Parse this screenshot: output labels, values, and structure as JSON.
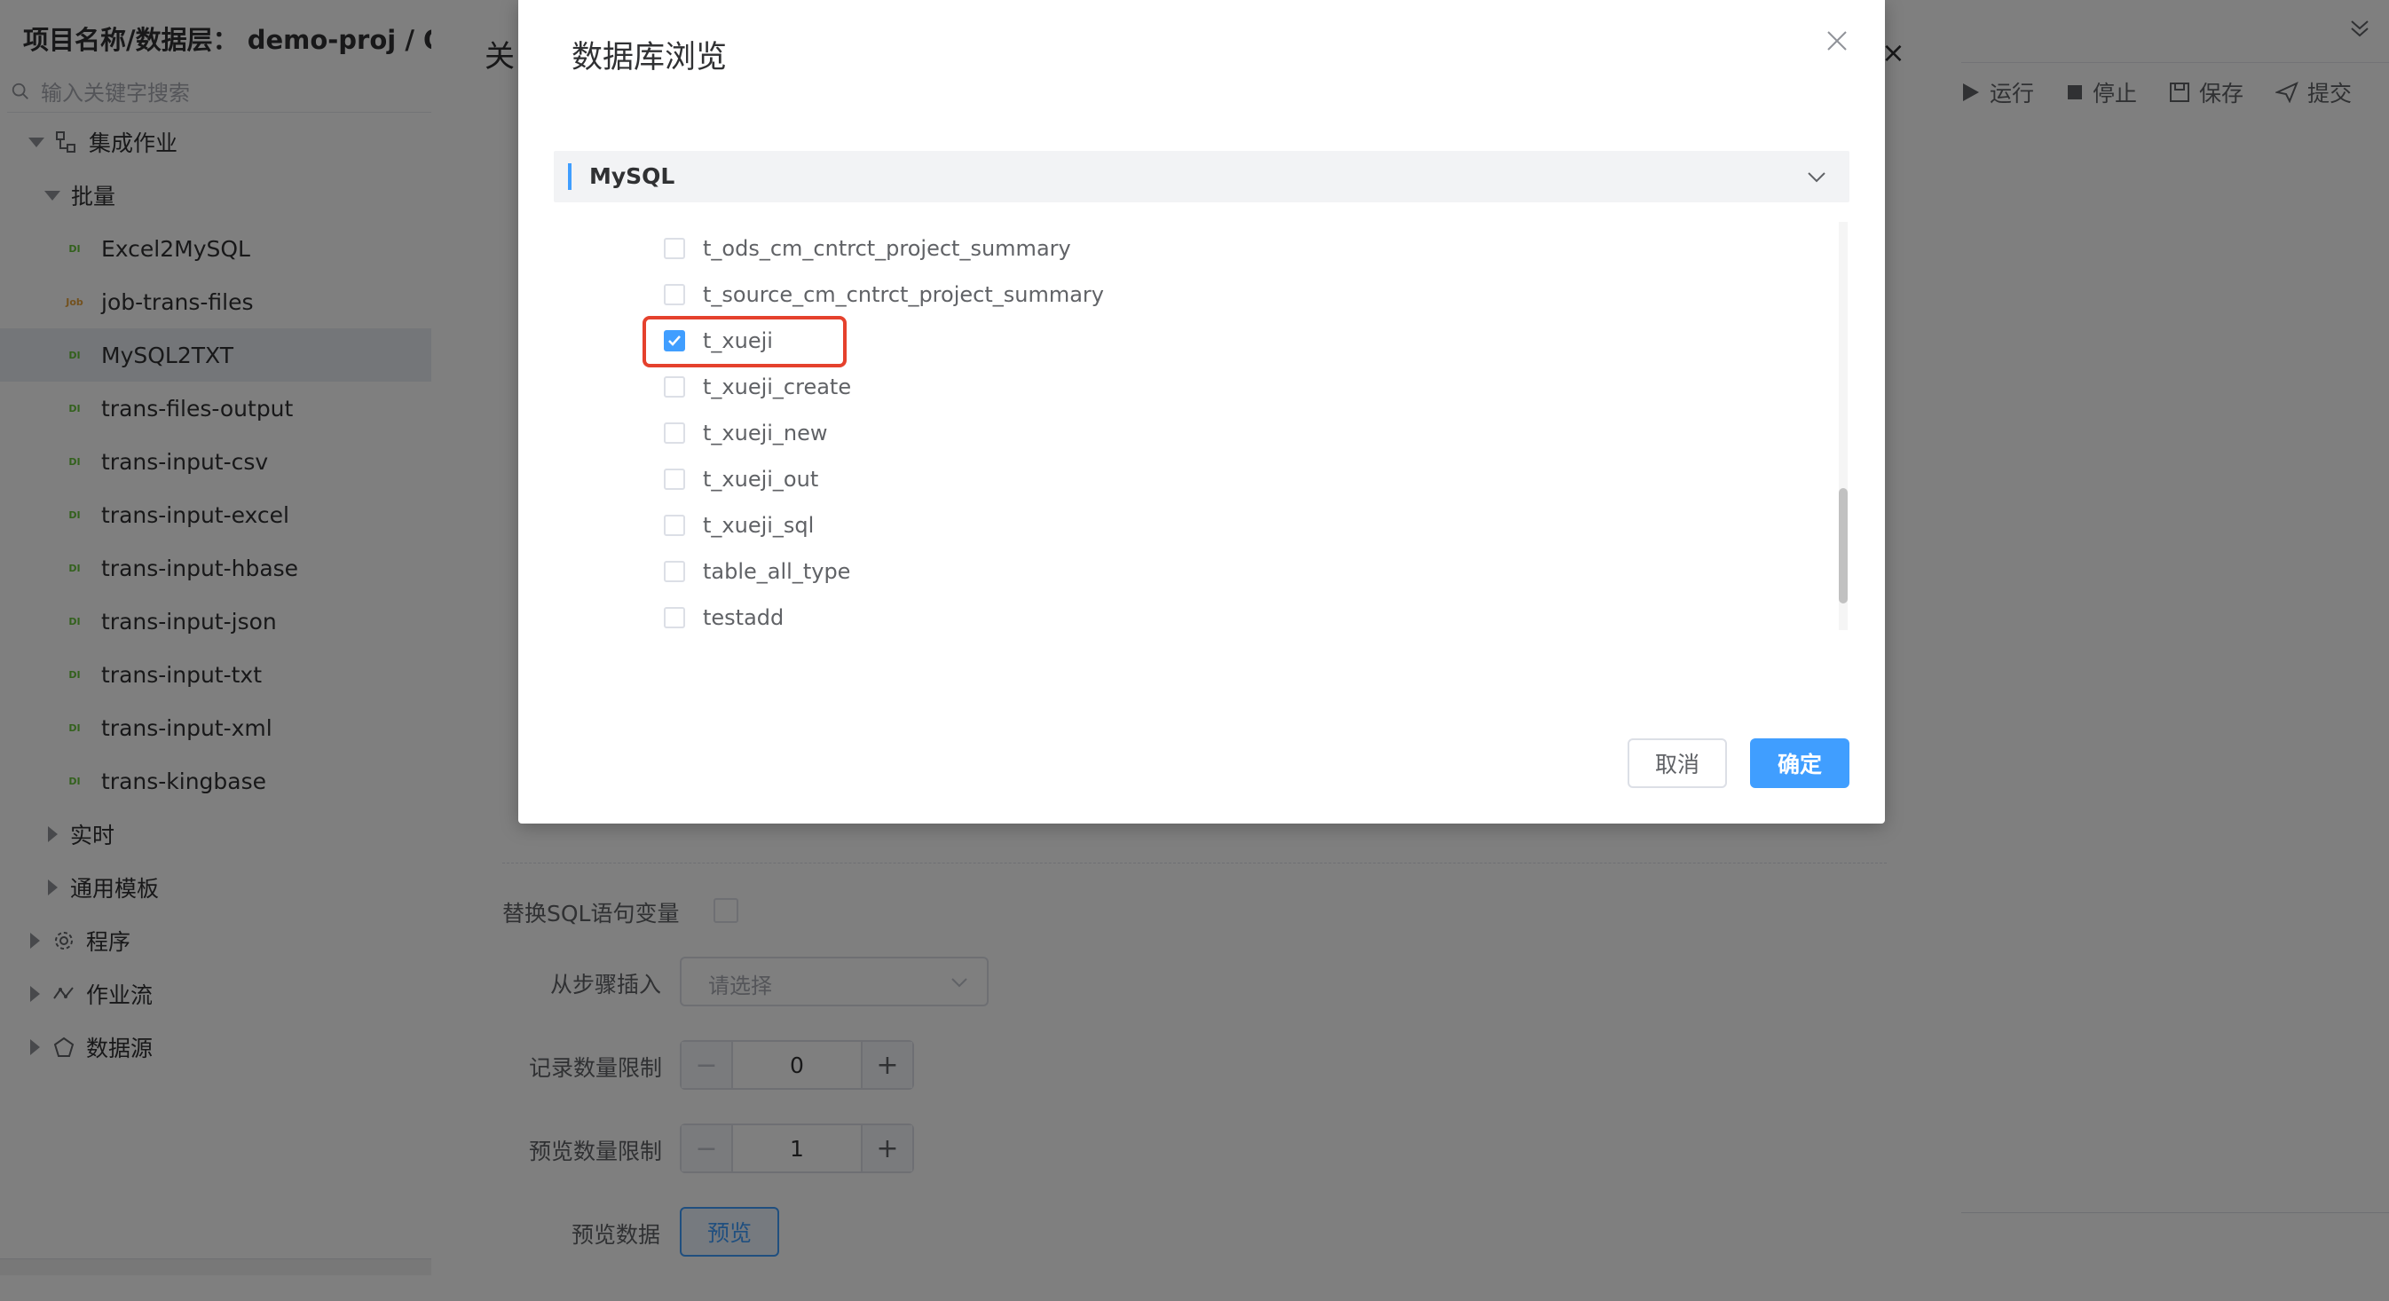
{
  "sidebar": {
    "project_title": "项目名称/数据层： demo-proj / ODS",
    "search_placeholder": "输入关键字搜索",
    "tree": {
      "integration_job": "集成作业",
      "batch": "批量",
      "batch_items": [
        {
          "badge": "DI",
          "label": "Excel2MySQL"
        },
        {
          "badge": "Job",
          "label": "job-trans-files"
        },
        {
          "badge": "DI",
          "label": "MySQL2TXT"
        },
        {
          "badge": "DI",
          "label": "trans-files-output"
        },
        {
          "badge": "DI",
          "label": "trans-input-csv"
        },
        {
          "badge": "DI",
          "label": "trans-input-excel"
        },
        {
          "badge": "DI",
          "label": "trans-input-hbase"
        },
        {
          "badge": "DI",
          "label": "trans-input-json"
        },
        {
          "badge": "DI",
          "label": "trans-input-txt"
        },
        {
          "badge": "DI",
          "label": "trans-input-xml"
        },
        {
          "badge": "DI",
          "label": "trans-kingbase"
        }
      ],
      "realtime": "实时",
      "common_template": "通用模板",
      "program": "程序",
      "workflow": "作业流",
      "datasource": "数据源"
    }
  },
  "editor": {
    "close_label": "关",
    "replace_sql_var_label": "替换SQL语句变量",
    "insert_from_step_label": "从步骤插入",
    "insert_from_step_placeholder": "请选择",
    "record_limit_label": "记录数量限制",
    "record_limit_value": "0",
    "preview_limit_label": "预览数量限制",
    "preview_limit_value": "1",
    "preview_data_label": "预览数据",
    "preview_button": "预览",
    "minus": "−",
    "plus": "+"
  },
  "toolbar": {
    "run": "运行",
    "stop": "停止",
    "save": "保存",
    "submit": "提交",
    "close_x": "×"
  },
  "modal": {
    "title": "数据库浏览",
    "db_type": "MySQL",
    "tables": [
      {
        "name": "t_ods_cm_cntrct_project_summary",
        "checked": false
      },
      {
        "name": "t_source_cm_cntrct_project_summary",
        "checked": false
      },
      {
        "name": "t_xueji",
        "checked": true
      },
      {
        "name": "t_xueji_create",
        "checked": false
      },
      {
        "name": "t_xueji_new",
        "checked": false
      },
      {
        "name": "t_xueji_out",
        "checked": false
      },
      {
        "name": "t_xueji_sql",
        "checked": false
      },
      {
        "name": "table_all_type",
        "checked": false
      },
      {
        "name": "testadd",
        "checked": false
      }
    ],
    "cancel": "取消",
    "confirm": "确定"
  },
  "colors": {
    "primary": "#409eff",
    "highlight": "#e5412d",
    "overlay": "rgba(0,0,0,0.5)"
  }
}
